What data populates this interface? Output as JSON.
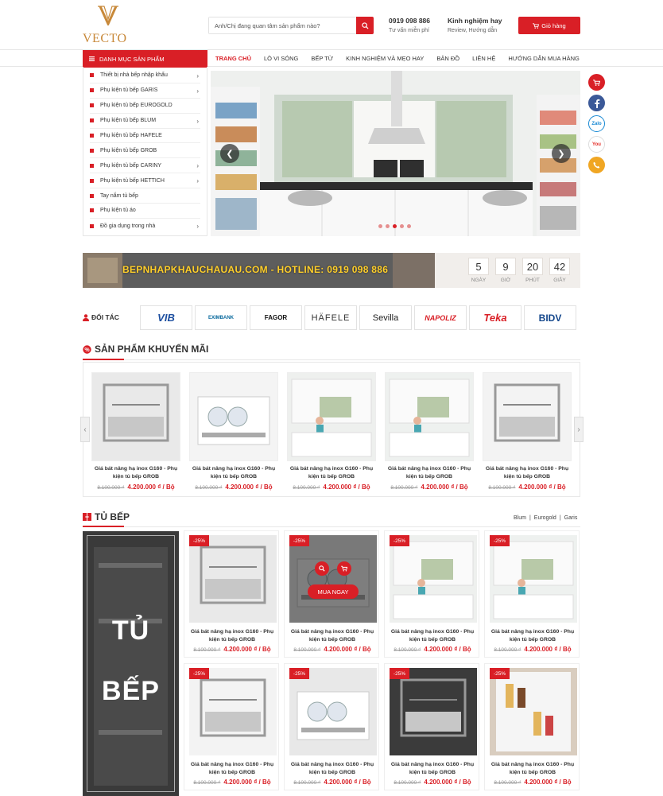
{
  "colors": {
    "accent": "#d91f26",
    "logo": "#c8893a",
    "banner_text": "#ffcf2a"
  },
  "header": {
    "logo_text": "VECTO",
    "search_placeholder": "Anh/Chị đang quan tâm sản phẩm nào?",
    "hotline": {
      "phone": "0919 098 886",
      "caption": "Tư vấn miễn phí"
    },
    "experience": {
      "title": "Kinh nghiệm hay",
      "caption": "Review, Hướng dẫn"
    },
    "cart_label": "Giỏ hàng"
  },
  "nav": {
    "category_header": "DANH MỤC SẢN PHẨM",
    "items": [
      "TRANG CHỦ",
      "LÒ VI SÓNG",
      "BẾP TỪ",
      "KINH NGHIỆM VÀ MẸO HAY",
      "BẢN ĐỒ",
      "LIÊN HỆ",
      "HƯỚNG DẪN MUA HÀNG"
    ],
    "active": "TRANG CHỦ"
  },
  "categories": [
    {
      "label": "Thiết bị nhà bếp nhập khẩu",
      "has_sub": true
    },
    {
      "label": "Phụ kiện tủ bếp GARIS",
      "has_sub": true
    },
    {
      "label": "Phụ kiện tủ bếp EUROGOLD",
      "has_sub": false
    },
    {
      "label": "Phụ kiện tủ bếp BLUM",
      "has_sub": true
    },
    {
      "label": "Phụ kiện tủ bếp HAFELE",
      "has_sub": false
    },
    {
      "label": "Phụ kiện tủ bếp GROB",
      "has_sub": false
    },
    {
      "label": "Phụ kiện tủ bếp CARINY",
      "has_sub": true
    },
    {
      "label": "Phụ kiện tủ bếp HETTICH",
      "has_sub": true
    },
    {
      "label": "Tay nắm tủ bếp",
      "has_sub": false
    },
    {
      "label": "Phụ kiện tủ áo",
      "has_sub": false
    },
    {
      "label": "Đồ gia dụng trong nhà",
      "has_sub": true
    }
  ],
  "hero": {
    "slides": 5,
    "active_slide": 3
  },
  "floating": [
    "cart-icon",
    "facebook-icon",
    "zalo-icon",
    "youtube-icon",
    "phone-icon"
  ],
  "floating_text": {
    "zalo": "Zalo",
    "youtube": "You"
  },
  "banner": {
    "text": "BEPNHAPKHAUCHAUAU.COM - HOTLINE: 0919 098 886",
    "countdown": [
      {
        "value": "5",
        "label": "NGÀY"
      },
      {
        "value": "9",
        "label": "GIỜ"
      },
      {
        "value": "20",
        "label": "PHÚT"
      },
      {
        "value": "42",
        "label": "GIÂY"
      }
    ]
  },
  "partners": {
    "heading": "ĐỐI TÁC",
    "logos": [
      "VIB",
      "EXIMBANK",
      "FAGOR",
      "HÄFELE",
      "Sevilla",
      "NAPOLIZ",
      "Teka",
      "BIDV"
    ]
  },
  "promo": {
    "title": "SẢN PHẨM KHUYẾN MÃI",
    "products": [
      {
        "name": "Giá bát nâng hạ inox G160 - Phụ kiện tủ bếp GROB",
        "old_price": "8.100.000 ₫",
        "price": "4.200.000 ₫ / Bộ"
      },
      {
        "name": "Giá bát nâng hạ inox G160 - Phụ kiện tủ bếp GROB",
        "old_price": "8.100.000 ₫",
        "price": "4.200.000 ₫ / Bộ"
      },
      {
        "name": "Giá bát nâng hạ inox G160 - Phụ kiện tủ bếp GROB",
        "old_price": "8.100.000 ₫",
        "price": "4.200.000 ₫ / Bộ"
      },
      {
        "name": "Giá bát nâng hạ inox G160 - Phụ kiện tủ bếp GROB",
        "old_price": "8.100.000 ₫",
        "price": "4.200.000 ₫ / Bộ"
      },
      {
        "name": "Giá bát nâng hạ inox G160 - Phụ kiện tủ bếp GROB",
        "old_price": "8.100.000 ₫",
        "price": "4.200.000 ₫ / Bộ"
      }
    ]
  },
  "kitchen": {
    "title": "TỦ BẾP",
    "links": [
      "Blum",
      "Eurogold",
      "Garis"
    ],
    "panel_words": [
      "TỦ",
      "BẾP"
    ],
    "buy_now": "MUA NGAY",
    "products": [
      {
        "badge": "-25%",
        "name": "Giá bát nâng hạ inox G160 - Phụ kiện tủ bếp GROB",
        "old_price": "8.100.000 ₫",
        "price": "4.200.000 ₫ / Bộ"
      },
      {
        "badge": "-25%",
        "name": "Giá bát nâng hạ inox G160 - Phụ kiện tủ bếp GROB",
        "old_price": "8.100.000 ₫",
        "price": "4.200.000 ₫ / Bộ"
      },
      {
        "badge": "-25%",
        "name": "Giá bát nâng hạ inox G160 - Phụ kiện tủ bếp GROB",
        "old_price": "8.100.000 ₫",
        "price": "4.200.000 ₫ / Bộ"
      },
      {
        "badge": "-25%",
        "name": "Giá bát nâng hạ inox G160 - Phụ kiện tủ bếp GROB",
        "old_price": "8.100.000 ₫",
        "price": "4.200.000 ₫ / Bộ"
      },
      {
        "badge": "-25%",
        "name": "Giá bát nâng hạ inox G160 - Phụ kiện tủ bếp GROB",
        "old_price": "8.100.000 ₫",
        "price": "4.200.000 ₫ / Bộ"
      },
      {
        "badge": "-25%",
        "name": "Giá bát nâng hạ inox G160 - Phụ kiện tủ bếp GROB",
        "old_price": "8.100.000 ₫",
        "price": "4.200.000 ₫ / Bộ"
      },
      {
        "badge": "-25%",
        "name": "Giá bát nâng hạ inox G160 - Phụ kiện tủ bếp GROB",
        "old_price": "8.100.000 ₫",
        "price": "4.200.000 ₫ / Bộ"
      },
      {
        "badge": "-25%",
        "name": "Giá bát nâng hạ inox G160 - Phụ kiện tủ bếp GROB",
        "old_price": "8.100.000 ₫",
        "price": "4.200.000 ₫ / Bộ"
      }
    ]
  }
}
